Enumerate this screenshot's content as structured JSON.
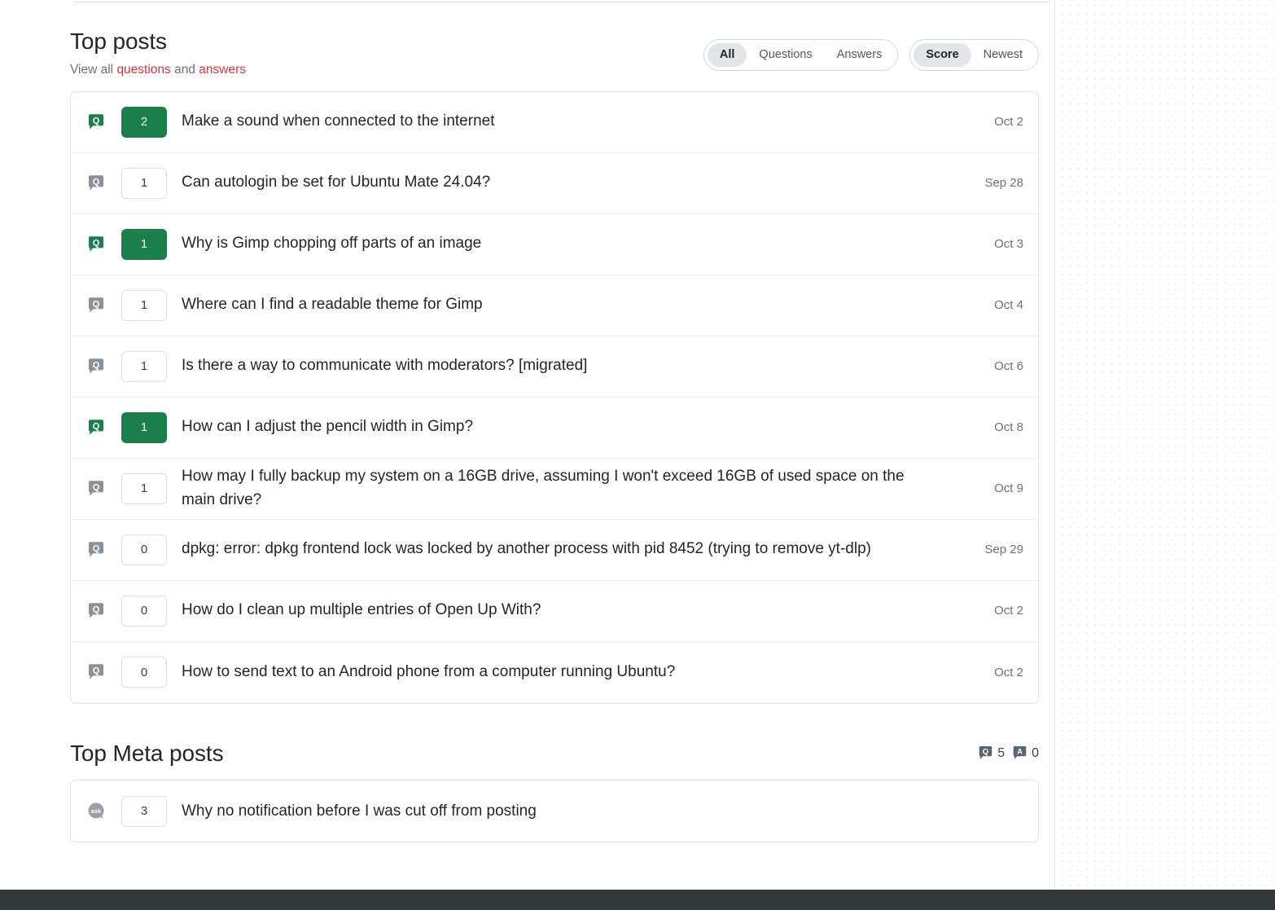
{
  "top_posts": {
    "title": "Top posts",
    "view_all_prefix": "View all ",
    "view_all_questions": "questions",
    "view_all_middle": " and ",
    "view_all_answers": "answers",
    "filters": {
      "type_group": [
        {
          "label": "All",
          "selected": true
        },
        {
          "label": "Questions",
          "selected": false
        },
        {
          "label": "Answers",
          "selected": false
        }
      ],
      "sort_group": [
        {
          "label": "Score",
          "selected": true
        },
        {
          "label": "Newest",
          "selected": false
        }
      ]
    },
    "rows": [
      {
        "icon": "question-icon",
        "answered": true,
        "score": "2",
        "title": "Make a sound when connected to the internet",
        "date": "Oct 2"
      },
      {
        "icon": "question-icon",
        "answered": false,
        "score": "1",
        "title": "Can autologin be set for Ubuntu Mate 24.04?",
        "date": "Sep 28"
      },
      {
        "icon": "question-icon",
        "answered": true,
        "score": "1",
        "title": "Why is Gimp chopping off parts of an image",
        "date": "Oct 3"
      },
      {
        "icon": "question-icon",
        "answered": false,
        "score": "1",
        "title": "Where can I find a readable theme for Gimp",
        "date": "Oct 4"
      },
      {
        "icon": "question-icon",
        "answered": false,
        "score": "1",
        "title": "Is there a way to communicate with moderators? [migrated]",
        "date": "Oct 6"
      },
      {
        "icon": "question-icon",
        "answered": true,
        "score": "1",
        "title": "How can I adjust the pencil width in Gimp?",
        "date": "Oct 8"
      },
      {
        "icon": "question-icon",
        "answered": false,
        "score": "1",
        "title": "How may I fully backup my system on a 16GB drive, assuming I won't exceed 16GB of used space on the main drive?",
        "date": "Oct 9"
      },
      {
        "icon": "question-icon",
        "answered": false,
        "score": "0",
        "title": "dpkg: error: dpkg frontend lock was locked by another process with pid 8452 (trying to remove yt-dlp)",
        "date": "Sep 29"
      },
      {
        "icon": "question-icon",
        "answered": false,
        "score": "0",
        "title": "How do I clean up multiple entries of Open Up With?",
        "date": "Oct 2"
      },
      {
        "icon": "question-icon",
        "answered": false,
        "score": "0",
        "title": "How to send text to an Android phone from a computer running Ubuntu?",
        "date": "Oct 2"
      }
    ]
  },
  "meta_posts": {
    "title": "Top Meta posts",
    "counts": [
      {
        "badge": "Q",
        "icon": "question-badge-icon",
        "value": "5"
      },
      {
        "badge": "A",
        "icon": "answer-badge-icon",
        "value": "0"
      }
    ],
    "rows": [
      {
        "icon": "ask-icon",
        "answered": false,
        "score": "3",
        "title": "Why no notification before I was cut off from posting"
      }
    ]
  },
  "colors": {
    "accepted_green": "#1a7f4b",
    "link_red": "#d1383d",
    "badge_slate": "#6a737c",
    "text": "#232629",
    "muted": "#6a737c"
  }
}
